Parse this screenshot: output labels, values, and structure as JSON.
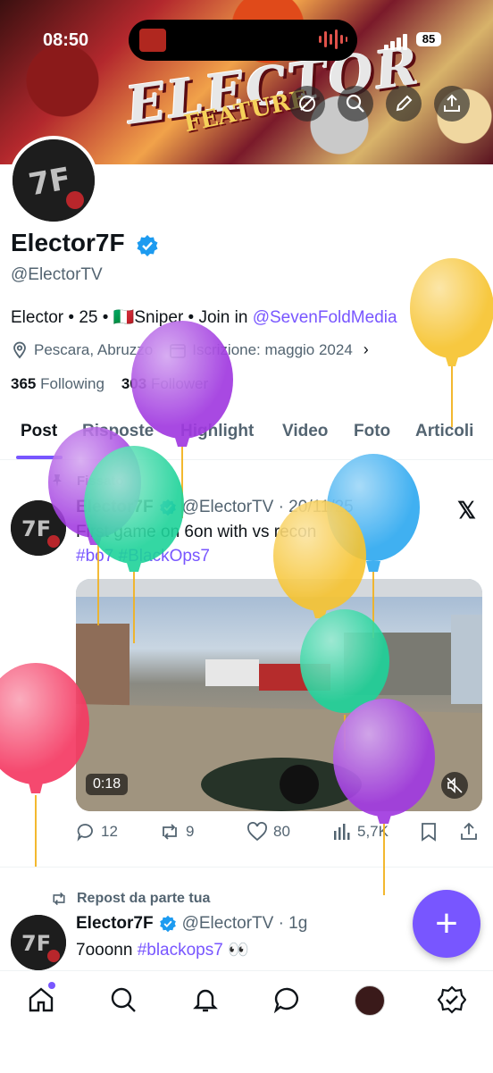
{
  "status_bar": {
    "time": "08:50",
    "battery": "85"
  },
  "banner": {
    "title_art": "ELECTOR",
    "subtitle_art": "FEATURE"
  },
  "profile": {
    "name": "Elector7F",
    "handle": "@ElectorTV",
    "bio_prefix": "Elector • 25 • 🇮🇹Sniper • Join in ",
    "bio_link": "@SevenFoldMedia",
    "location": "Pescara, Abruzzo",
    "joined": "Iscrizione: maggio 2024",
    "following_count": "365",
    "following_label": "Following",
    "followers_count": "303",
    "followers_label": "Follower"
  },
  "tabs": [
    "Post",
    "Risposte",
    "Highlight",
    "Video",
    "Foto",
    "Articoli"
  ],
  "pinned_post": {
    "pinned_label": "Fissato",
    "name": "Elector7F",
    "handle_date": "@ElectorTV · 20/11/25",
    "text": "First game on 6on with vs recon",
    "hashtags": "#bo7 #BlackOps7",
    "video_time": "0:18",
    "replies": "12",
    "reposts": "9",
    "likes": "80",
    "views": "5,7K"
  },
  "second_post": {
    "repost_label": "Repost da parte tua",
    "name": "Elector7F",
    "handle_date": "@ElectorTV · 1g",
    "text": "7ooonn ",
    "hashtag": "#blackops7",
    "emoji": "👀"
  },
  "fab_label": "+",
  "colors": {
    "accent": "#7856ff",
    "verified": "#1d9bf0",
    "muted": "#536471"
  },
  "bottom_nav": [
    "home-icon",
    "search-icon",
    "bell-icon",
    "messages-icon",
    "profile-avatar",
    "grok-icon"
  ]
}
